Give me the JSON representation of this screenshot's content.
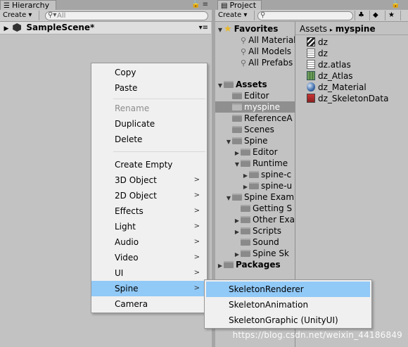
{
  "hierarchy": {
    "tab_title": "Hierarchy",
    "create_label": "Create",
    "search_placeholder": "All",
    "scene_name": "SampleScene*"
  },
  "project": {
    "tab_title": "Project",
    "create_label": "Create",
    "breadcrumb": [
      "Assets",
      "myspine"
    ],
    "tree": [
      {
        "label": "Favorites",
        "bold": true,
        "icon": "star-icon"
      },
      {
        "label": "All Materials",
        "icon": "search-icon"
      },
      {
        "label": "All Models",
        "icon": "search-icon"
      },
      {
        "label": "All Prefabs",
        "icon": "search-icon"
      },
      {
        "label": "Assets",
        "bold": true,
        "icon": "folder-icon"
      },
      {
        "label": "Editor",
        "icon": "folder-icon"
      },
      {
        "label": "myspine",
        "icon": "folder-icon",
        "selected": true
      },
      {
        "label": "ReferenceA",
        "icon": "folder-icon"
      },
      {
        "label": "Scenes",
        "icon": "folder-icon"
      },
      {
        "label": "Spine",
        "icon": "folder-icon"
      },
      {
        "label": "Editor",
        "icon": "folder-icon"
      },
      {
        "label": "Runtime",
        "icon": "folder-icon"
      },
      {
        "label": "spine-c",
        "icon": "folder-icon"
      },
      {
        "label": "spine-u",
        "icon": "folder-icon"
      },
      {
        "label": "Spine Exam",
        "icon": "folder-icon"
      },
      {
        "label": "Getting S",
        "icon": "folder-icon"
      },
      {
        "label": "Other Exa",
        "icon": "folder-icon"
      },
      {
        "label": "Scripts",
        "icon": "folder-icon"
      },
      {
        "label": "Sound",
        "icon": "folder-icon"
      },
      {
        "label": "Spine Sk",
        "icon": "folder-icon"
      },
      {
        "label": "Packages",
        "bold": true,
        "icon": "folder-icon"
      }
    ],
    "assets": [
      {
        "label": "dz",
        "icon": "texture-icon"
      },
      {
        "label": "dz",
        "icon": "text-file-icon"
      },
      {
        "label": "dz.atlas",
        "icon": "text-file-icon"
      },
      {
        "label": "dz_Atlas",
        "icon": "atlas-icon"
      },
      {
        "label": "dz_Material",
        "icon": "material-sphere-icon"
      },
      {
        "label": "dz_SkeletonData",
        "icon": "skeleton-data-icon"
      }
    ]
  },
  "context_menu": {
    "items": [
      {
        "label": "Copy"
      },
      {
        "label": "Paste"
      },
      {
        "label": "Rename",
        "disabled": true
      },
      {
        "label": "Duplicate"
      },
      {
        "label": "Delete"
      },
      {
        "label": "Create Empty"
      },
      {
        "label": "3D Object",
        "submenu": true
      },
      {
        "label": "2D Object",
        "submenu": true
      },
      {
        "label": "Effects",
        "submenu": true
      },
      {
        "label": "Light",
        "submenu": true
      },
      {
        "label": "Audio",
        "submenu": true
      },
      {
        "label": "Video",
        "submenu": true
      },
      {
        "label": "UI",
        "submenu": true
      },
      {
        "label": "Spine",
        "submenu": true,
        "highlighted": true
      },
      {
        "label": "Camera"
      }
    ],
    "submenu_items": [
      {
        "label": "SkeletonRenderer",
        "highlighted": true
      },
      {
        "label": "SkeletonAnimation"
      },
      {
        "label": "SkeletonGraphic (UnityUI)"
      }
    ]
  },
  "watermark": "https://blog.csdn.net/weixin_44186849",
  "colors": {
    "highlight": "#91c9f7",
    "selection": "#8f8f8f",
    "panel_bg": "#c2c2c2"
  }
}
